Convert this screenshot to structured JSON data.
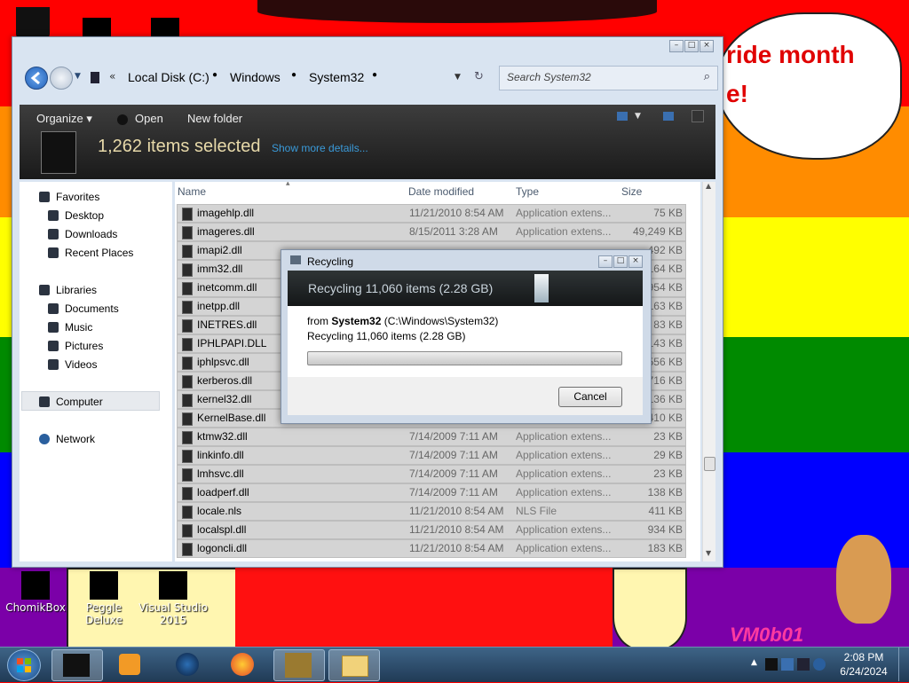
{
  "wallpaper": {
    "colors": [
      "#ff0000",
      "#ff8c00",
      "#ffff00",
      "#008a00",
      "#0000ff",
      "#7b00a8"
    ],
    "speech_text_line1": "ride month",
    "speech_text_line2": "e!",
    "watermark": "VM0b01"
  },
  "desktop_icons": [
    {
      "label": "ChomikBox"
    },
    {
      "label": "Peggle Deluxe"
    },
    {
      "label": "Visual Studio 2015"
    }
  ],
  "explorer": {
    "title_buttons": [
      "minimize",
      "maximize",
      "close"
    ],
    "breadcrumb": [
      "Local Disk (C:)",
      "Windows",
      "System32"
    ],
    "search_placeholder": "Search System32",
    "toolbar": {
      "organize": "Organize",
      "open": "Open",
      "new_folder": "New folder"
    },
    "selection": {
      "title": "1,262 items selected",
      "details_link": "Show more details..."
    },
    "nav": {
      "favorites": "Favorites",
      "desktop": "Desktop",
      "downloads": "Downloads",
      "recent_places": "Recent Places",
      "libraries": "Libraries",
      "documents": "Documents",
      "music": "Music",
      "pictures": "Pictures",
      "videos": "Videos",
      "computer": "Computer",
      "network": "Network"
    },
    "columns": {
      "name": "Name",
      "date": "Date modified",
      "type": "Type",
      "size": "Size"
    },
    "files": [
      {
        "name": "imagehlp.dll",
        "date": "11/21/2010 8:54 AM",
        "type": "Application extens...",
        "size": "75 KB"
      },
      {
        "name": "imageres.dll",
        "date": "8/15/2011 3:28 AM",
        "type": "Application extens...",
        "size": "49,249 KB"
      },
      {
        "name": "imapi2.dll",
        "date": "",
        "type": "",
        "size": "492 KB"
      },
      {
        "name": "imm32.dll",
        "date": "",
        "type": "",
        "size": "164 KB"
      },
      {
        "name": "inetcomm.dll",
        "date": "",
        "type": "",
        "size": "954 KB"
      },
      {
        "name": "inetpp.dll",
        "date": "",
        "type": "",
        "size": "163 KB"
      },
      {
        "name": "INETRES.dll",
        "date": "",
        "type": "",
        "size": "83 KB"
      },
      {
        "name": "IPHLPAPI.DLL",
        "date": "",
        "type": "",
        "size": "143 KB"
      },
      {
        "name": "iphlpsvc.dll",
        "date": "",
        "type": "",
        "size": "556 KB"
      },
      {
        "name": "kerberos.dll",
        "date": "",
        "type": "",
        "size": "716 KB"
      },
      {
        "name": "kernel32.dll",
        "date": "",
        "type": "",
        "size": "136 KB"
      },
      {
        "name": "KernelBase.dll",
        "date": "",
        "type": "",
        "size": "410 KB"
      },
      {
        "name": "ktmw32.dll",
        "date": "7/14/2009 7:11 AM",
        "type": "Application extens...",
        "size": "23 KB"
      },
      {
        "name": "linkinfo.dll",
        "date": "7/14/2009 7:11 AM",
        "type": "Application extens...",
        "size": "29 KB"
      },
      {
        "name": "lmhsvc.dll",
        "date": "7/14/2009 7:11 AM",
        "type": "Application extens...",
        "size": "23 KB"
      },
      {
        "name": "loadperf.dll",
        "date": "7/14/2009 7:11 AM",
        "type": "Application extens...",
        "size": "138 KB"
      },
      {
        "name": "locale.nls",
        "date": "11/21/2010 8:54 AM",
        "type": "NLS File",
        "size": "411 KB"
      },
      {
        "name": "localspl.dll",
        "date": "11/21/2010 8:54 AM",
        "type": "Application extens...",
        "size": "934 KB"
      },
      {
        "name": "logoncli.dll",
        "date": "11/21/2010 8:54 AM",
        "type": "Application extens...",
        "size": "183 KB"
      }
    ]
  },
  "dialog": {
    "title": "Recycling",
    "banner": "Recycling 11,060 items (2.28 GB)",
    "from_prefix": "from",
    "from_name": "System32",
    "from_path": "(C:\\Windows\\System32)",
    "status": "Recycling 11,060 items (2.28 GB)",
    "progress": 0,
    "cancel": "Cancel"
  },
  "taskbar": {
    "time": "2:08 PM",
    "date": "6/24/2024"
  }
}
